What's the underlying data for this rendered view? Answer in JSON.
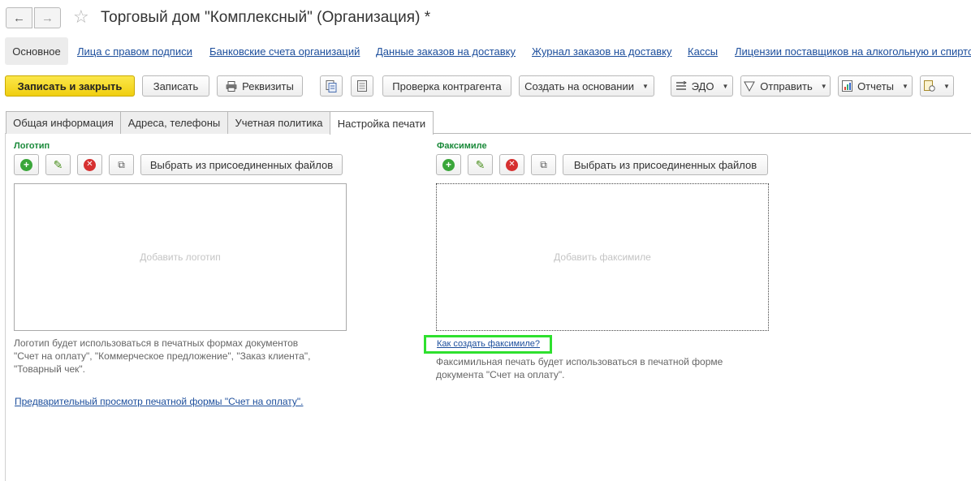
{
  "window": {
    "title": "Торговый дом \"Комплексный\" (Организация) *",
    "back_icon": "←",
    "forward_icon": "→",
    "star_icon": "☆"
  },
  "sections": {
    "active": "Основное",
    "links": [
      "Лица с правом подписи",
      "Банковские счета организаций",
      "Данные заказов на доставку",
      "Журнал заказов на доставку",
      "Кассы",
      "Лицензии поставщиков на алкогольную и спирто"
    ]
  },
  "toolbar": {
    "save_close": "Записать и закрыть",
    "save": "Записать",
    "requisites": "Реквизиты",
    "check_counterparty": "Проверка контрагента",
    "create_based": "Создать на основании",
    "edo": "ЭДО",
    "send": "Отправить",
    "reports": "Отчеты"
  },
  "tabs": [
    "Общая информация",
    "Адреса, телефоны",
    "Учетная политика",
    "Настройка печати"
  ],
  "logo": {
    "title": "Логотип",
    "choose_button": "Выбрать из присоединенных файлов",
    "placeholder": "Добавить логотип",
    "note_lines": [
      "Логотип будет использоваться в печатных формах документов",
      "\"Счет на оплату\", \"Коммерческое предложение\", \"Заказ клиента\",",
      "\"Товарный чек\"."
    ],
    "preview_link": "Предварительный просмотр печатной формы \"Счет на оплату\"."
  },
  "facsimile": {
    "title": "Факсимиле",
    "choose_button": "Выбрать  из присоединенных файлов",
    "placeholder": "Добавить факсимиле",
    "howto_link": "Как создать факсимиле?",
    "note_lines": [
      "Факсимильная печать будет использоваться в печатной форме",
      "документа \"Счет на оплату\"."
    ]
  },
  "colors": {
    "primary_button": "#f0cf10",
    "group_title": "#1a8a3a",
    "link": "#1c4e9c",
    "highlight": "#2ee02e"
  }
}
